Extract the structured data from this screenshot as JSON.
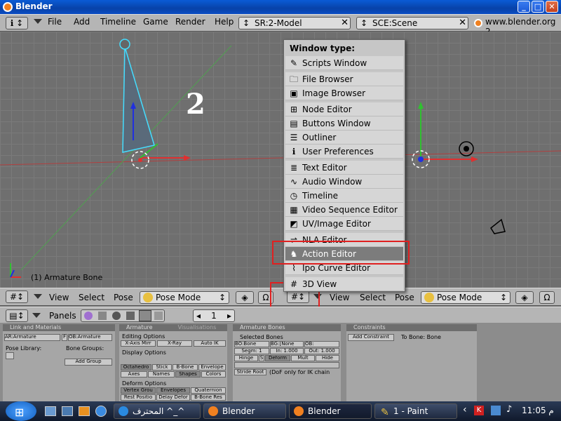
{
  "window": {
    "title": "Blender"
  },
  "top_header": {
    "menus": [
      "File",
      "Add",
      "Timeline",
      "Game",
      "Render",
      "Help"
    ],
    "screen_field": "SR:2-Model",
    "scene_field": "SCE:Scene",
    "website": "www.blender.org 2"
  },
  "viewport": {
    "big_label": "2",
    "status": "(1) Armature Bone"
  },
  "menu": {
    "title": "Window type:",
    "items": [
      {
        "label": "Scripts Window",
        "icon": "scripts-icon"
      },
      {
        "label": "File Browser",
        "icon": "file-browser-icon"
      },
      {
        "label": "Image Browser",
        "icon": "image-browser-icon"
      },
      {
        "label": "Node Editor",
        "icon": "node-editor-icon"
      },
      {
        "label": "Buttons Window",
        "icon": "buttons-window-icon"
      },
      {
        "label": "Outliner",
        "icon": "outliner-icon"
      },
      {
        "label": "User Preferences",
        "icon": "user-preferences-icon"
      },
      {
        "label": "Text Editor",
        "icon": "text-editor-icon"
      },
      {
        "label": "Audio Window",
        "icon": "audio-window-icon"
      },
      {
        "label": "Timeline",
        "icon": "timeline-icon"
      },
      {
        "label": "Video Sequence Editor",
        "icon": "video-sequence-icon"
      },
      {
        "label": "UV/Image Editor",
        "icon": "uv-image-icon"
      },
      {
        "label": "NLA Editor",
        "icon": "nla-editor-icon"
      },
      {
        "label": "Action Editor",
        "icon": "action-editor-icon"
      },
      {
        "label": "Ipo Curve Editor",
        "icon": "ipo-curve-icon"
      },
      {
        "label": "3D View",
        "icon": "3d-view-icon"
      }
    ],
    "selected": "Action Editor"
  },
  "view_header_left": {
    "menus": [
      "View",
      "Select",
      "Pose"
    ],
    "mode": "Pose Mode"
  },
  "view_header_right": {
    "menus": [
      "View",
      "Select",
      "Pose"
    ],
    "mode": "Pose Mode"
  },
  "buttons_header": {
    "panels_label": "Panels",
    "frame": "1"
  },
  "panels": {
    "link": {
      "title": "Link and Materials",
      "armature_field": "AR:Armature",
      "f_label": "F",
      "ob_field": "OB:Armature",
      "pose_library": "Pose Library:",
      "bone_groups": "Bone Groups:",
      "add_group": "Add Group"
    },
    "armature": {
      "tab1": "Armature",
      "tab2": "Visualisations",
      "editing_options": "Editing Options",
      "xaxis_mirror": "X-Axis Mirr",
      "xray": "X-Ray",
      "auto_ik": "Auto IK",
      "display_options": "Display Options",
      "octahedron": "Octahedro",
      "stick": "Stick",
      "bbone": "B-Bone",
      "envelope": "Envelope",
      "axes": "Axes",
      "names": "Names",
      "shapes": "Shapes",
      "colors": "Colors",
      "deform_options": "Deform Options",
      "vertex_groups": "Vertex Grou",
      "envelopes": "Envelopes",
      "quaternion": "Quaternion",
      "rest_position": "Rest Positio",
      "delay_deform": "Delay Defor",
      "bbone_rest": "B-Bone Res"
    },
    "bones": {
      "title": "Armature Bones",
      "selected_bones": "Selected Bones",
      "bo_field": "BO:Bone",
      "bg_field": "BG:[None",
      "ob_field": "OB:",
      "segm": "Segm: 1",
      "in_field": "In: 1.000",
      "out_field": "Out: 1.000",
      "hinge": "Hinge",
      "s_label": "S",
      "deform": "Deform",
      "mult": "Mult",
      "hide": "Hide",
      "stride_root": "Stride Root",
      "stride_note": "(DoF only for IK chain"
    },
    "constraints": {
      "title": "Constraints",
      "add_constraint": "Add Constraint",
      "to_bone": "To Bone: Bone"
    }
  },
  "taskbar": {
    "tasks": [
      "^_^ المحترف",
      "Blender",
      "Blender",
      "1 - Paint"
    ],
    "clock": "11:05 م"
  },
  "colors": {
    "accent": "#0a5bd6",
    "menu_selected": "#7c7c7c",
    "highlight_box": "#e02020"
  }
}
